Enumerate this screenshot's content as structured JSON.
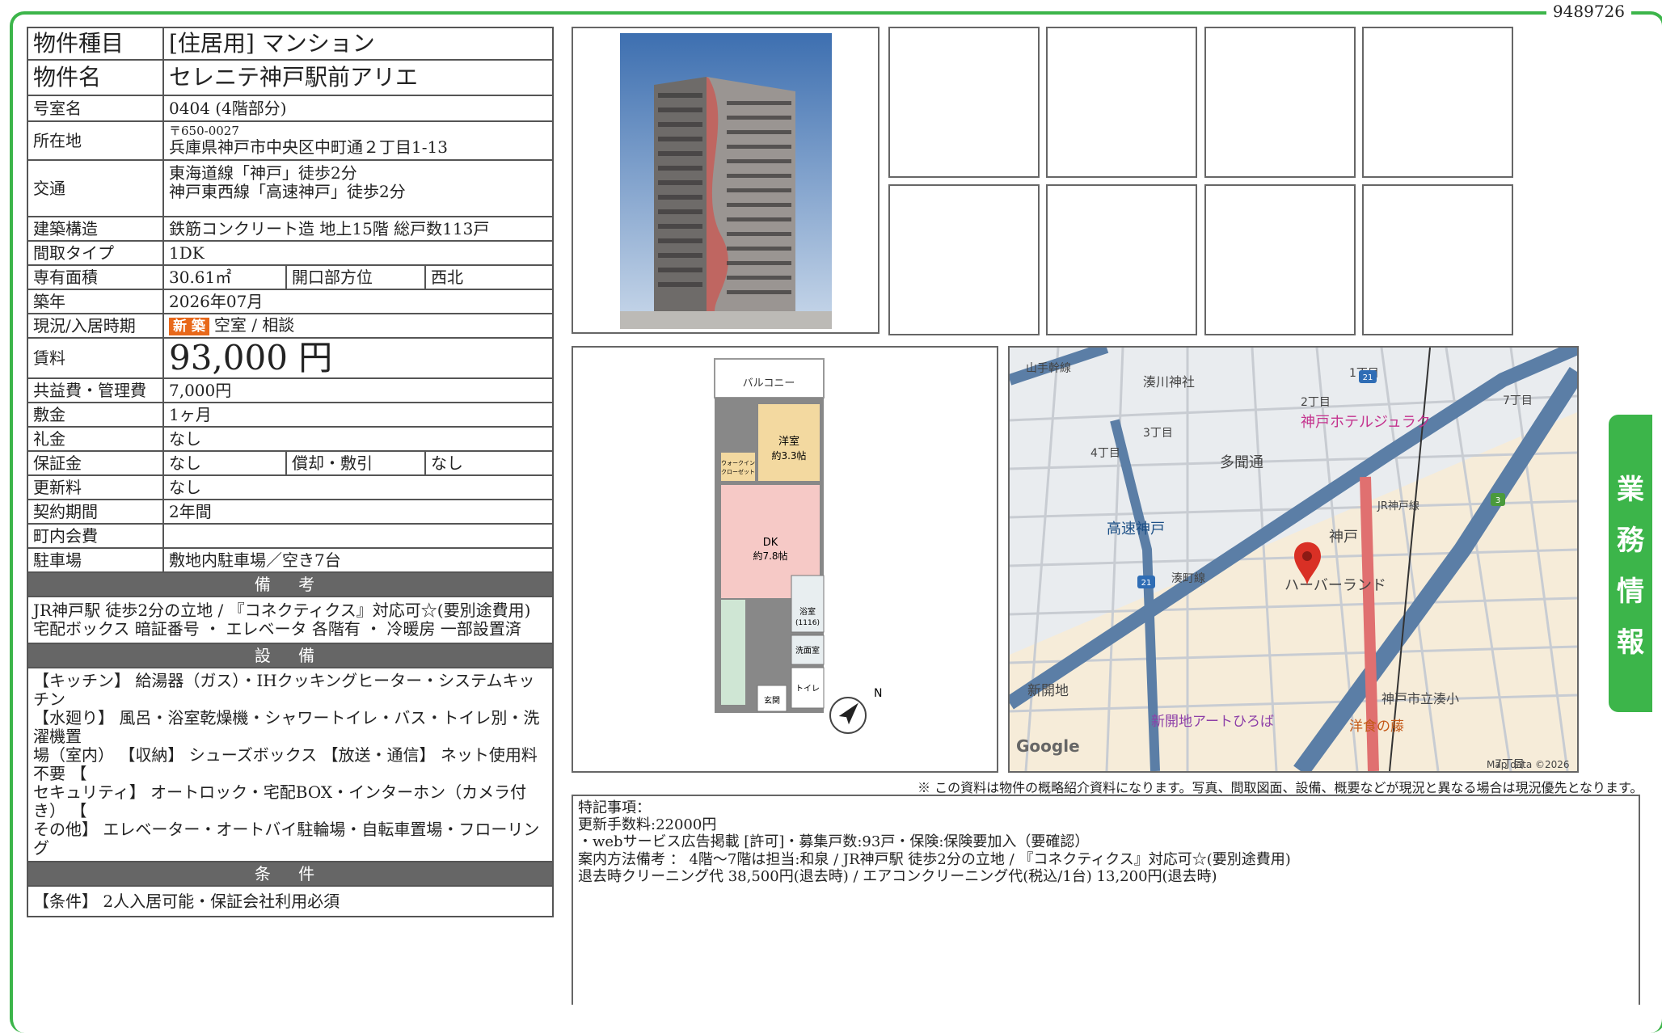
{
  "doc_id": "9489726",
  "side_tab": [
    "業",
    "務",
    "情",
    "報"
  ],
  "property": {
    "type_label": "物件種目",
    "type_value": "[住居用] マンション",
    "name_label": "物件名",
    "name_value": "セレニテ神戸駅前アリエ",
    "room_label": "号室名",
    "room_value": "0404 (4階部分)",
    "address_label": "所在地",
    "zip": "〒650-0027",
    "address_value": "兵庫県神戸市中央区中町通２丁目1-13",
    "access_label": "交通",
    "access_1": "東海道線「神戸」徒歩2分",
    "access_2": "神戸東西線「高速神戸」徒歩2分",
    "structure_label": "建築構造",
    "structure_value": "鉄筋コンクリート造 地上15階 総戸数113戸",
    "layout_label": "間取タイプ",
    "layout_value": "1DK",
    "area_label": "専有面積",
    "area_value": "30.61㎡",
    "direction_label": "開口部方位",
    "direction_value": "西北",
    "built_label": "築年",
    "built_value": "2026年07月",
    "status_label": "現況/入居時期",
    "status_badge": "新 築",
    "status_value": "空室 / 相談",
    "rent_label": "賃料",
    "rent_value": "93,000 円",
    "fee_label": "共益費・管理費",
    "fee_value": "7,000円",
    "deposit_label": "敷金",
    "deposit_value": "1ヶ月",
    "key_money_label": "礼金",
    "key_money_value": "なし",
    "guarantee_label": "保証金",
    "guarantee_value": "なし",
    "amort_label": "償却・敷引",
    "amort_value": "なし",
    "renewal_label": "更新料",
    "renewal_value": "なし",
    "contract_label": "契約期間",
    "contract_value": "2年間",
    "assoc_label": "町内会費",
    "assoc_value": "",
    "parking_label": "駐車場",
    "parking_value": "敷地内駐車場／空き7台"
  },
  "sections": {
    "remarks_title": "備 考",
    "remarks_1": "JR神戸駅 徒歩2分の立地 / 『コネクティクス』対応可☆(要別途費用)",
    "remarks_2": "宅配ボックス 暗証番号 ・ エレベータ 各階有 ・ 冷暖房 一部設置済",
    "equip_title": "設 備",
    "equip_1": "【キッチン】 給湯器（ガス）・IHクッキングヒーター・システムキッチン",
    "equip_2": "【水廻り】 風呂・浴室乾燥機・シャワートイレ・バス・トイレ別・洗濯機置",
    "equip_3": "場（室内） 【収納】 シューズボックス 【放送・通信】 ネット使用料不要 【",
    "equip_4": "セキュリティ】 オートロック・宅配BOX・インターホン（カメラ付き） 【",
    "equip_5": "その他】 エレベーター・オートバイ駐輪場・自転車置場・フローリング",
    "cond_title": "条 件",
    "cond_1": "【条件】 2人入居可能・保証会社利用必須"
  },
  "floorplan": {
    "balcony": "バルコニー",
    "western": "洋室",
    "western_size": "約3.3帖",
    "walkin": "ウォークイン",
    "closet": "クローゼット",
    "dk": "DK",
    "dk_size": "約7.8帖",
    "bath": "浴室",
    "bath_size": "(1116)",
    "washroom": "洗面室",
    "toilet": "トイレ",
    "entrance": "玄関",
    "north": "N"
  },
  "map": {
    "labels": {
      "minatogawa": "湊川神社",
      "kobe_hotel": "神戸ホテルジュラク",
      "tamon": "多聞通",
      "kosoku_kobe": "高速神戸",
      "kobe": "神戸",
      "harborland": "ハーバーランド",
      "shinkaichi": "新開地",
      "art": "新開地アートひろば",
      "yoshoku": "洋食の藤",
      "minato_school": "神戸市立湊小",
      "yamate": "山手幹線",
      "jr": "JR神戸線",
      "minatomachi": "湊町線",
      "google": "Google",
      "credit": "Map data ©2026",
      "c1": "1丁目",
      "c2": "2丁目",
      "c3": "3丁目",
      "c4": "4丁目",
      "c7": "7丁目",
      "r21": "21",
      "r3": "3"
    }
  },
  "caption": "※ この資料は物件の概略紹介資料になります。写真、間取図面、設備、概要などが現況と異なる場合は現況優先となります。",
  "special": {
    "l1": "特記事項：",
    "l2": "更新手数料:22000円",
    "l3": "・webサービス広告掲載 [許可]・募集戸数:93戸・保険:保険要加入（要確認）",
    "l4": "案内方法備考 ： 4階～7階は担当:和泉 / JR神戸駅 徒歩2分の立地 / 『コネクティクス』対応可☆(要別途費用)",
    "l5": "退去時クリーニング代 38,500円(退去時) / エアコンクリーニング代(税込/1台) 13,200円(退去時)"
  },
  "colors": {
    "frame": "#3cb54a",
    "section_bg": "#666666",
    "badge": "#e8681a"
  }
}
